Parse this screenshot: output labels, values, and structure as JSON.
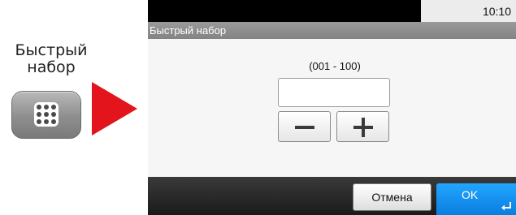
{
  "instruction": {
    "key_label_line1": "Быстрый",
    "key_label_line2": "набор",
    "key_icon": "keypad-dots-icon",
    "arrow_icon": "right-arrow-icon",
    "arrow_color": "#e3141b"
  },
  "status": {
    "time": "10:10"
  },
  "header": {
    "title": "Быстрый набор"
  },
  "main": {
    "range_label": "(001 - 100)",
    "input_value": "",
    "minus_icon": "minus-icon",
    "plus_icon": "plus-icon"
  },
  "footer": {
    "cancel_label": "Отмена",
    "ok_label": "OK",
    "ok_icon": "enter-icon",
    "ok_color": "#1a90f0"
  }
}
